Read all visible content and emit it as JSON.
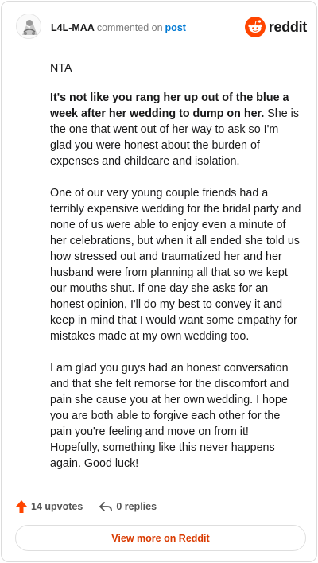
{
  "header": {
    "username": "L4L-MAA",
    "verb": "commented on",
    "post_link": "post",
    "brand_name": "reddit"
  },
  "comment": {
    "p1": "NTA",
    "p2_bold": "It's not like you rang her up out of the blue a week after her wedding to dump on her.",
    "p2_rest": " She is the one that went out of her way to ask so I'm glad you were honest about the burden of expenses and childcare and isolation.",
    "p3": "One of our very young couple friends had a terribly expensive wedding for the bridal party and none of us were able to enjoy even a minute of her celebrations, but when it all ended she told us how stressed out and traumatized her and her husband were from planning all that so we kept our mouths shut. If one day she asks for an honest opinion, I'll do my best to convey it and keep in mind that I would want some empathy for mistakes made at my own wedding too.",
    "p4": "I am glad you guys had an honest conversation and that she felt remorse for the discomfort and pain she cause you at her own wedding. I hope you are both able to forgive each other for the pain you're feeling and move on from it! Hopefully, something like this never happens again. Good luck!"
  },
  "actions": {
    "upvotes": "14 upvotes",
    "replies": "0 replies"
  },
  "footer": {
    "view_button": "View more on Reddit"
  },
  "colors": {
    "accent": "#d93a00",
    "upvote_arrow": "#ff4500",
    "link": "#0079d3"
  },
  "icons": {
    "avatar": "user-avatar-icon",
    "brand": "reddit-logo-icon",
    "upvote": "upvote-arrow-icon",
    "reply": "reply-arrow-icon"
  }
}
